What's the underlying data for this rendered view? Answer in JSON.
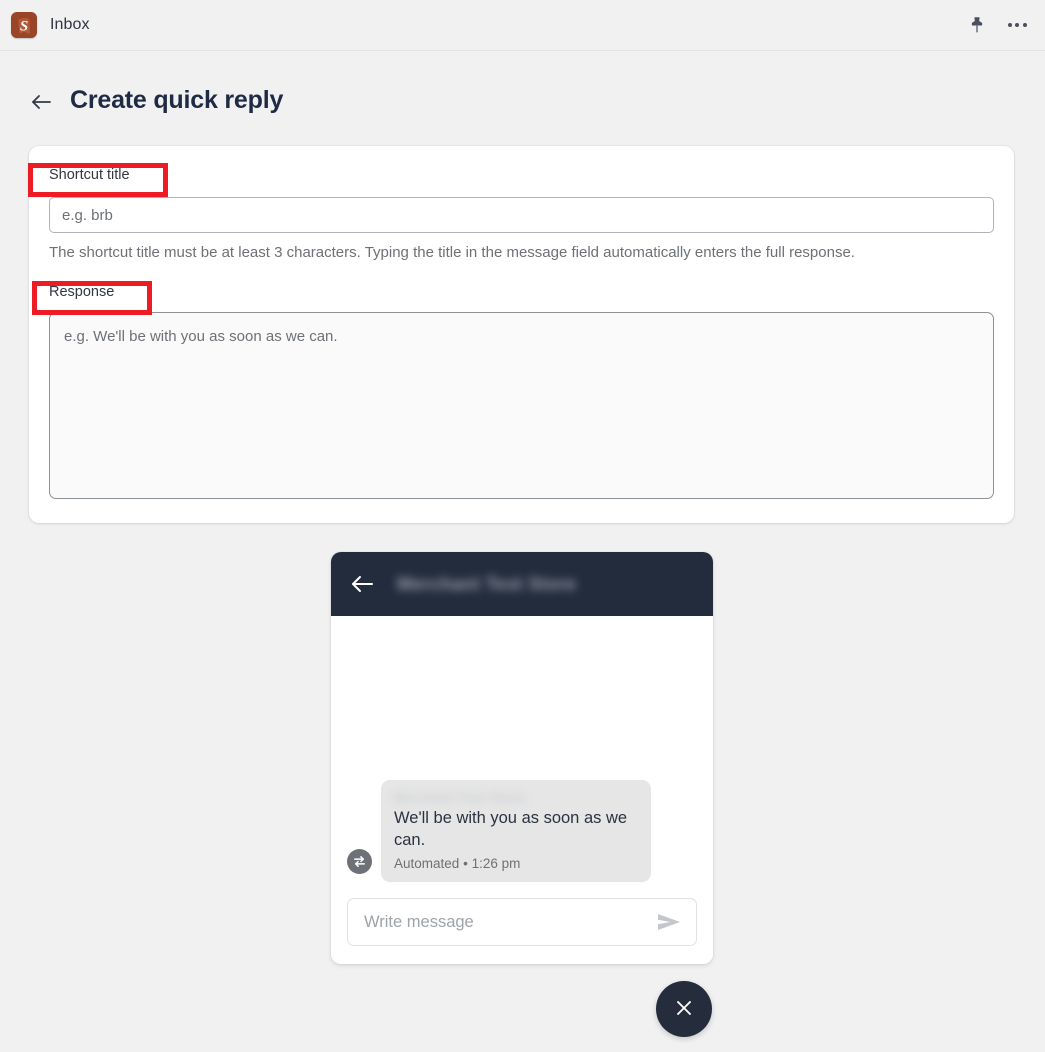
{
  "topbar": {
    "app_name": "Inbox",
    "logo_letter": "S",
    "logo_color": "#9a4528",
    "pin_icon": "pushpin-icon",
    "more_icon": "more-horizontal-icon"
  },
  "header": {
    "back_label": "back-arrow",
    "title": "Create quick reply"
  },
  "form": {
    "shortcut": {
      "label": "Shortcut title",
      "value": "",
      "placeholder": "e.g. brb",
      "helper": "The shortcut title must be at least 3 characters. Typing the title in the message field automatically enters the full response."
    },
    "response": {
      "label": "Response",
      "value": "",
      "placeholder": "e.g. We'll be with you as soon as we can."
    },
    "annotation_color": "#ed1c24"
  },
  "preview": {
    "header": {
      "back_icon": "arrow-left-icon",
      "store_name": "Merchant Test Store",
      "store_name_redacted": true,
      "background": "#232c3d"
    },
    "message": {
      "sender": "Merchant Test Store",
      "sender_redacted": true,
      "text": "We'll be with you as soon as we can.",
      "status": "Automated",
      "separator": "•",
      "time": "1:26 pm",
      "badge_icon": "swap-arrows-icon"
    },
    "composer": {
      "value": "",
      "placeholder": "Write message",
      "send_icon": "send-icon"
    }
  },
  "close_button": {
    "label": "close-icon",
    "background": "#252c3b"
  }
}
